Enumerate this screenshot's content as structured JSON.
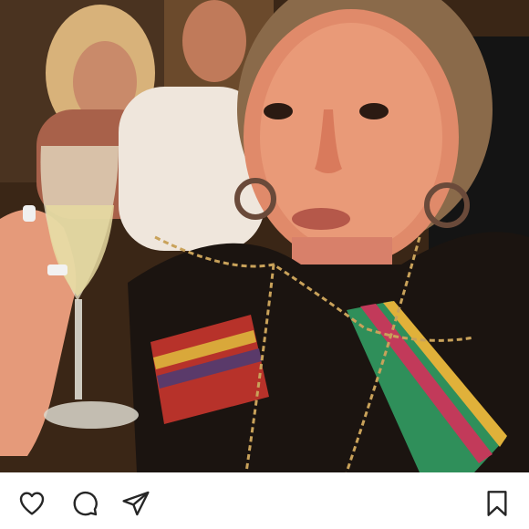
{
  "post": {
    "photo_alt": "",
    "actions": {
      "like_icon": "heart-icon",
      "comment_icon": "comment-bubble-icon",
      "share_icon": "paper-plane-icon",
      "save_icon": "bookmark-icon"
    },
    "colors": {
      "icon_stroke": "#262626",
      "background": "#ffffff"
    }
  }
}
